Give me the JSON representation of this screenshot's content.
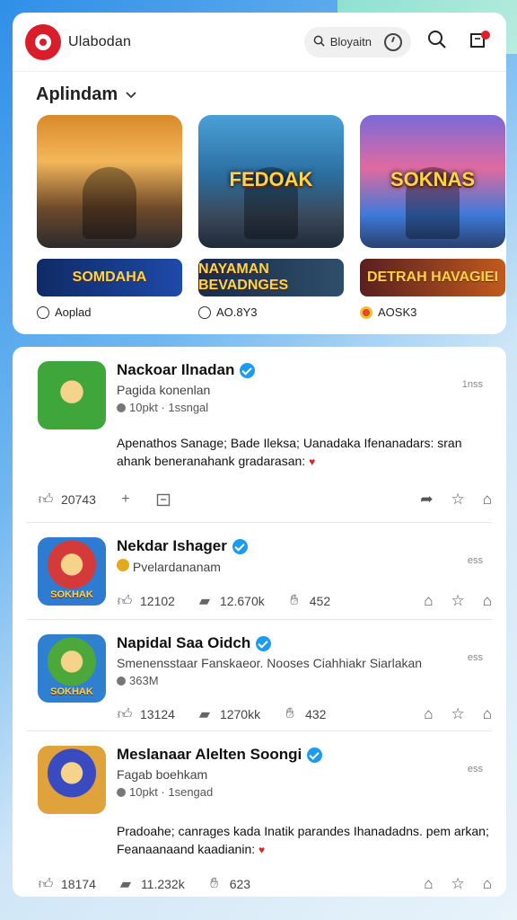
{
  "header": {
    "app_title": "Ulabodan",
    "pill_label": "Bloyaitn",
    "colors": {
      "brand": "#d91d2a",
      "verified": "#1d9bf0",
      "accent_bg": "#2f8fe8"
    }
  },
  "featured": {
    "section_title": "Aplindam",
    "cards": [
      {
        "thumb_text": "",
        "banner": "SOMDAHA",
        "meta": "Aoplad"
      },
      {
        "thumb_text": "FEDOAK",
        "banner": "NAYAMAN BEVADNGES",
        "meta": "AO.8Y3"
      },
      {
        "thumb_text": "SOKNAS",
        "banner": "DETRAH HAVAGIEI",
        "meta": "AOSK3"
      }
    ]
  },
  "feed": {
    "posts": [
      {
        "name": "Nackoar Ilnadan",
        "sub": "Pagida konenlan",
        "meta": "10pkt · 1ssngal",
        "time": "1nss",
        "avatar_label": "",
        "text": "Apenathos Sanage; Bade Ileksa; Uanadaka Ifenanadars: sran ahank beneranahank gradarasan:",
        "actions": {
          "likes": "20743",
          "comments": "",
          "shares": ""
        }
      },
      {
        "name": "Nekdar Ishager",
        "sub": "Pvelardananam",
        "meta": "",
        "time": "ess",
        "avatar_label": "SOKHAK",
        "text": "",
        "actions": {
          "likes": "12102",
          "comments": "12.670k",
          "shares": "452"
        }
      },
      {
        "name": "Napidal Saa Oidch",
        "sub": "Smenensstaar Fanskaeor. Nooses Ciahhiakr Siarlakan",
        "meta": "363M",
        "time": "ess",
        "avatar_label": "SOKHAK",
        "text": "",
        "actions": {
          "likes": "13124",
          "comments": "1270kk",
          "shares": "432"
        }
      },
      {
        "name": "Meslanaar Alelten Soongi",
        "sub": "Fagab boehkam",
        "meta": "10pkt · 1sengad",
        "time": "ess",
        "avatar_label": "",
        "text": "Pradoahe; canrages kada Inatik parandes Ihanadadns. pem arkan; Feanaanaand kaadianin:",
        "actions": {
          "likes": "18174",
          "comments": "11.232k",
          "shares": "623"
        }
      }
    ]
  }
}
